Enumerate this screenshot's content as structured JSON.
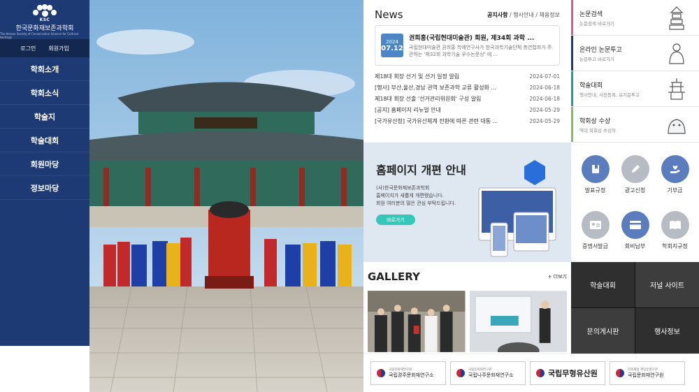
{
  "sidebar": {
    "logo_abbr": "KSC",
    "logo_name": "한국문화재보존과학회",
    "logo_sub": "The Korean Society of Conservation Science for Cultural Heritage",
    "login": "로그인",
    "join": "회원가입",
    "menu": [
      "학회소개",
      "학회소식",
      "학술지",
      "학술대회",
      "회원마당",
      "정보마당"
    ]
  },
  "news": {
    "title": "News",
    "tabs": {
      "active": "공지사항",
      "t2": "행사안내",
      "t3": "채용정보",
      "sep": "/"
    },
    "featured": {
      "year": "2024",
      "date": "07.12",
      "title": "권희홍(국립현대미술관) 회원, 제34회 과학 ...",
      "body": "국립현대미술관 권희홍 학예연구사가 한국과학기술단체 총연합회가 주관하는 '제32회 과학기술 우수논문상' 에 ..."
    },
    "items": [
      {
        "title": "제18대 회장 선거 및 선거 일정 알림",
        "date": "2024-07-01"
      },
      {
        "title": "[행사] 부산,울산,경남 권역 보존과학 교류 활성화 ...",
        "date": "2024-06-18"
      },
      {
        "title": "제18대 회장 선출 '선거관리위원회' 구성 알림",
        "date": "2024-06-18"
      },
      {
        "title": "[공지] 홈페이지 리뉴얼 안내",
        "date": "2024-05-29"
      },
      {
        "title": "[국가유산청] 국가유산체계 전환에 따른 관련 대통 ...",
        "date": "2024-05-29"
      }
    ]
  },
  "quick": [
    {
      "title": "논문검색",
      "sub": "논문검색 바로가기",
      "color": "#d65a8c",
      "icon": "pagoda-icon"
    },
    {
      "title": "온라인 논문투고",
      "sub": "논문투고 바로가기",
      "color": "#1e3a75",
      "icon": "buddha-icon"
    },
    {
      "title": "학술대회",
      "sub": "행사안내, 사전등록, 요지문투고",
      "color": "#20a08c",
      "icon": "stone-pagoda-icon"
    },
    {
      "title": "학회상 수상",
      "sub": "역대 학회상 수상자",
      "color": "#7cc35a",
      "icon": "haetae-icon"
    }
  ],
  "banner": {
    "title": "홈페이지 개편 안내",
    "line1": "(사)한국문화재보존과학회",
    "line2": "홈페이지가 새롭게 개편됐습니다.",
    "line3": "회원 여러분의 많은 관심 부탁드립니다.",
    "button": "바로가기"
  },
  "icon_menu": [
    {
      "label": "발표규정",
      "icon": "bookmark-book-icon",
      "color": "#5b7dbe"
    },
    {
      "label": "광고신청",
      "icon": "pencil-icon",
      "color": "#b7bcc4"
    },
    {
      "label": "기부금",
      "icon": "heart-hand-icon",
      "color": "#5b7dbe"
    },
    {
      "label": "증명서발급",
      "icon": "id-card-icon",
      "color": "#b7bcc4"
    },
    {
      "label": "회비납부",
      "icon": "credit-card-icon",
      "color": "#5b7dbe"
    },
    {
      "label": "학회지규정",
      "icon": "open-book-icon",
      "color": "#b7bcc4"
    }
  ],
  "gallery": {
    "title": "GALLERY",
    "more": "+ 더보기"
  },
  "tiles": [
    "학술대회",
    "저널 사이트",
    "문의게시판",
    "행사정보"
  ],
  "footer": [
    {
      "small": "국립문화재연구원",
      "big": "국립경주문화재연구소"
    },
    {
      "small": "국립문화재연구원",
      "big": "국립나주문화재연구소"
    },
    {
      "strong": "국립무형유산원"
    },
    {
      "small": "문화재청 책임운영기관",
      "big": "국립문화재연구원"
    }
  ]
}
